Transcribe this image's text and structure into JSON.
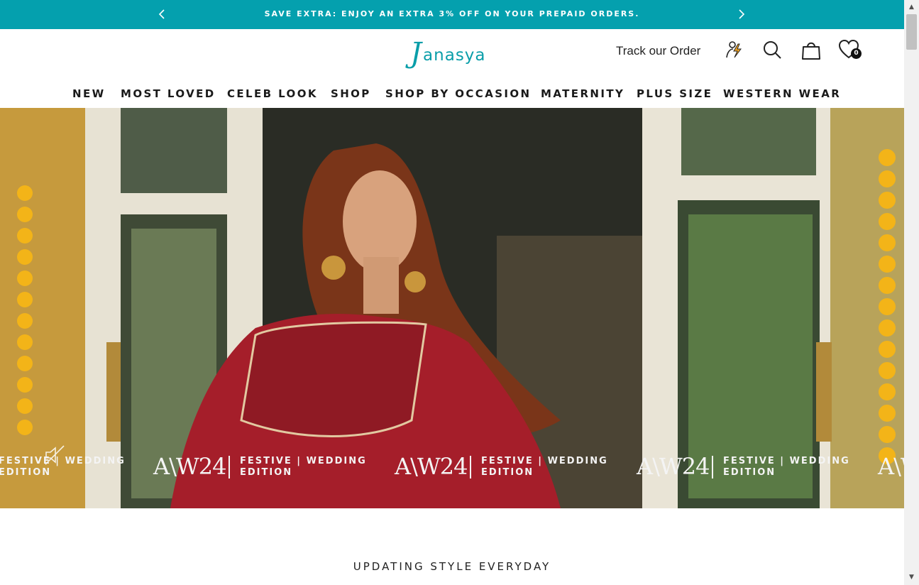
{
  "announcement": {
    "text": "SAVE EXTRA: ENJOY AN EXTRA 3% OFF ON YOUR PREPAID ORDERS.",
    "prev_icon": "chevron-left-icon",
    "next_icon": "chevron-right-icon"
  },
  "header": {
    "logo_first": "J",
    "logo_rest": "anasya",
    "track_label": "Track our Order",
    "wishlist_count": "0",
    "icons": [
      "flash-person-icon",
      "search-icon",
      "shopping-bag-icon",
      "heart-icon"
    ]
  },
  "nav": {
    "items": [
      "NEW",
      "MOST LOVED",
      "CELEB LOOK",
      "SHOP",
      "SHOP BY OCCASION",
      "MATERNITY",
      "PLUS SIZE",
      "WESTERN WEAR"
    ]
  },
  "hero": {
    "marquee": {
      "main": "A\\W24",
      "line1": "FESTIVE | WEDDING",
      "line2": "EDITION"
    },
    "mute_icon": "speaker-mute-icon"
  },
  "section": {
    "tagline": "UPDATING STYLE EVERYDAY"
  },
  "colors": {
    "accent": "#04a0ae",
    "dress": "#a51e2a"
  }
}
